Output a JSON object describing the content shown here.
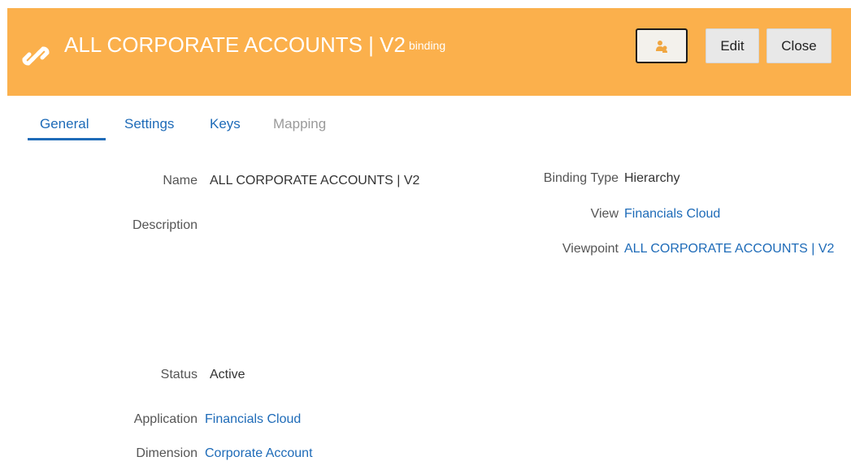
{
  "header": {
    "title": "ALL CORPORATE ACCOUNTS | V2",
    "subtitle": "binding",
    "icon": "link-icon",
    "color": "#fbb04c"
  },
  "buttons": {
    "user_icon": "user-group-icon",
    "edit": "Edit",
    "close": "Close"
  },
  "tabs": [
    {
      "label": "General",
      "state": "active"
    },
    {
      "label": "Settings",
      "state": "normal"
    },
    {
      "label": "Keys",
      "state": "normal"
    },
    {
      "label": "Mapping",
      "state": "disabled"
    }
  ],
  "fields": {
    "name": {
      "label": "Name",
      "value": "ALL CORPORATE ACCOUNTS | V2"
    },
    "description": {
      "label": "Description",
      "value": ""
    },
    "status": {
      "label": "Status",
      "value": "Active"
    },
    "application": {
      "label": "Application",
      "value": "Financials Cloud"
    },
    "dimension": {
      "label": "Dimension",
      "value": "Corporate Account"
    },
    "binding_type": {
      "label": "Binding Type",
      "value": "Hierarchy"
    },
    "view": {
      "label": "View",
      "value": "Financials Cloud"
    },
    "viewpoint": {
      "label": "Viewpoint",
      "value": "ALL CORPORATE ACCOUNTS | V2"
    }
  }
}
